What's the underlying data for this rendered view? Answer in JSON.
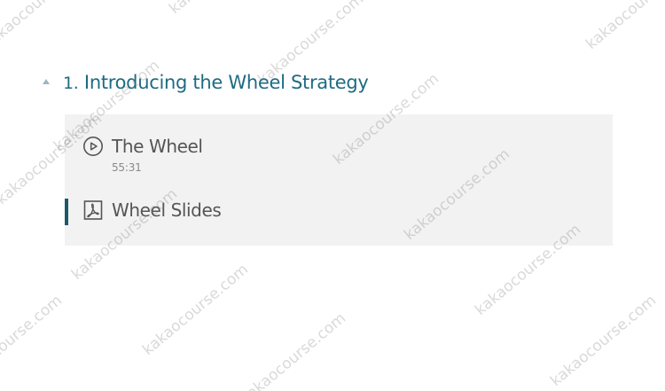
{
  "section": {
    "collapse_icon": "caret-up-icon",
    "number": "1.",
    "title": "Introducing the Wheel Strategy"
  },
  "lectures": [
    {
      "icon": "play-circle-icon",
      "title": "The Wheel",
      "duration": "55:31"
    },
    {
      "icon": "pdf-file-icon",
      "title": "Wheel Slides",
      "active": true
    }
  ],
  "colors": {
    "section_title": "#1e6b82",
    "panel_background": "#f2f2f2",
    "active_indicator": "#1c5a67",
    "lecture_text": "#555555"
  },
  "watermark": {
    "text": "kakaocourse.com"
  }
}
